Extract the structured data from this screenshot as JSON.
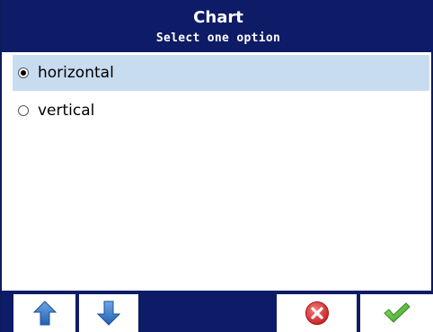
{
  "dialog": {
    "title": "Chart",
    "subtitle": "Select one option"
  },
  "options": [
    {
      "label": "horizontal",
      "selected": true
    },
    {
      "label": "vertical",
      "selected": false
    }
  ],
  "toolbar": {
    "up_icon": "arrow-up-icon",
    "down_icon": "arrow-down-icon",
    "cancel_icon": "cancel-icon",
    "ok_icon": "checkmark-icon"
  },
  "colors": {
    "titlebar": "#0e1b66",
    "selected_row": "#c8dcf0",
    "arrow_blue": "#2f73c4",
    "cancel_red": "#d8282a",
    "ok_green": "#5cbf3a"
  }
}
